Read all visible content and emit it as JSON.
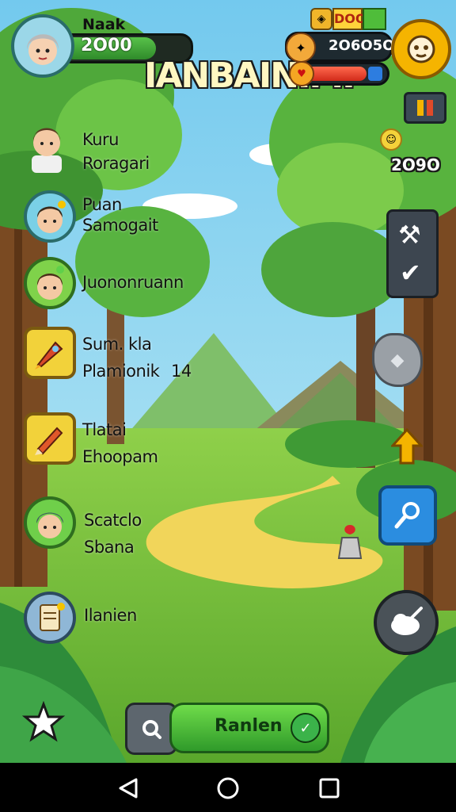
{
  "player": {
    "name": "Naak",
    "score": "2O00"
  },
  "title_banner": "IANBAINIMI",
  "resource": {
    "amount": "2O6O5O",
    "tag": "DOO"
  },
  "coin_counter": "2O9O",
  "characters": [
    {
      "line1": "Kuru",
      "line2": "Roragari"
    },
    {
      "line1": "Puan",
      "line2": "Samogait"
    },
    {
      "line1": "Juononruann",
      "line2": ""
    },
    {
      "line1": "Sum. kla",
      "line2": "Plamionik",
      "extra": "14"
    },
    {
      "line1": "Tlatai",
      "line2": "Ehoopam"
    },
    {
      "line1": "Scatclo",
      "line2": "Sbana"
    },
    {
      "line1": "Ilanien",
      "line2": ""
    }
  ],
  "bottom_button": "Ranlen",
  "colors": {
    "accent_green": "#3bb34a",
    "hp_red": "#e53a2a",
    "gold": "#f5b400",
    "sky": "#8fd6f2",
    "grass": "#7cc63a"
  }
}
